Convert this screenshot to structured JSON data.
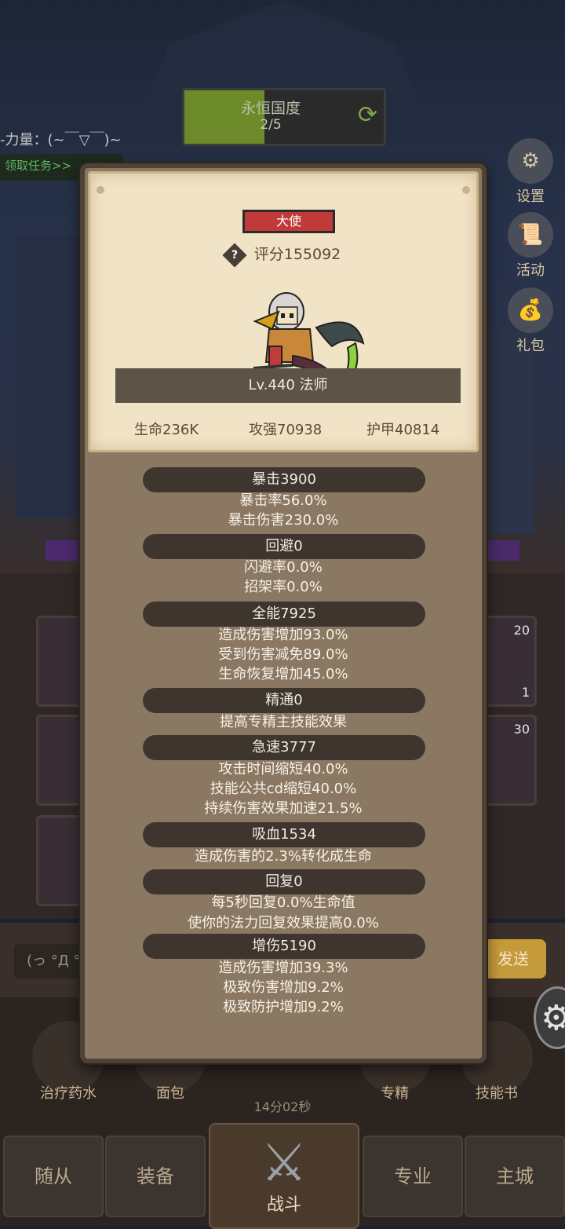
{
  "background": {
    "realm_title": "永恒国度",
    "realm_progress": "2/5",
    "realm_fill_percent": 40,
    "power_text": "-力量：(~￣▽￣)~",
    "task_button": "领取任务>>",
    "side_buttons": [
      {
        "label": "设置",
        "icon": "gear-icon"
      },
      {
        "label": "活动",
        "icon": "scroll-icon"
      },
      {
        "label": "礼包",
        "icon": "giftbag-icon"
      }
    ],
    "slot_counts": [
      "20",
      "1",
      "30"
    ],
    "chat_placeholder": "(っ °Д °;",
    "send_label": "发送",
    "items": [
      {
        "label": "治疗药水"
      },
      {
        "label": "面包"
      },
      {
        "label": "专精"
      },
      {
        "label": "技能书"
      }
    ],
    "timer": "14分02秒",
    "nav": {
      "followers": "随从",
      "equipment": "装备",
      "battle": "战斗",
      "profession": "专业",
      "main_city": "主城"
    }
  },
  "panel": {
    "title_badge": "大使",
    "score": "评分155092",
    "level_class": "Lv.440 法师",
    "hp": "生命236K",
    "attack": "攻强70938",
    "armor": "护甲40814",
    "sections": [
      {
        "head": "暴击3900",
        "lines": [
          "暴击率56.0%",
          "暴击伤害230.0%"
        ]
      },
      {
        "head": "回避0",
        "lines": [
          "闪避率0.0%",
          "招架率0.0%"
        ]
      },
      {
        "head": "全能7925",
        "lines": [
          "造成伤害增加93.0%",
          "受到伤害减免89.0%",
          "生命恢复增加45.0%"
        ]
      },
      {
        "head": "精通0",
        "lines": [
          "提高专精主技能效果"
        ]
      },
      {
        "head": "急速3777",
        "lines": [
          "攻击时间缩短40.0%",
          "技能公共cd缩短40.0%",
          "持续伤害效果加速21.5%"
        ]
      },
      {
        "head": "吸血1534",
        "lines": [
          "造成伤害的2.3%转化成生命"
        ]
      },
      {
        "head": "回复0",
        "lines": [
          "每5秒回复0.0%生命值",
          "使你的法力回复效果提高0.0%"
        ]
      },
      {
        "head": "增伤5190",
        "lines": [
          "造成伤害增加39.3%",
          "极致伤害增加9.2%",
          "极致防护增加9.2%"
        ]
      }
    ]
  }
}
